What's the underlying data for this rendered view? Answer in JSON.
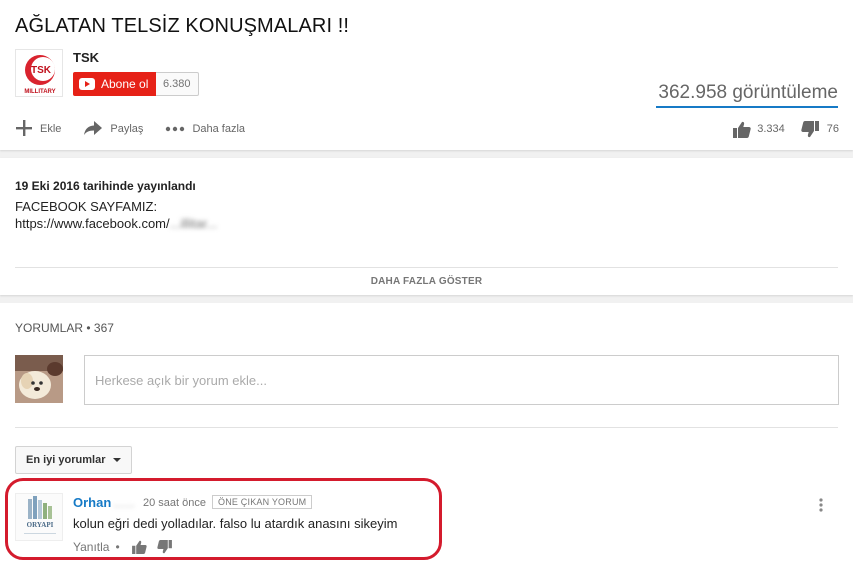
{
  "video": {
    "title": "AĞLATAN TELSİZ KONUŞMALARI !!",
    "views": "362.958 görüntüleme",
    "likes": "3.334",
    "dislikes": "76"
  },
  "channel": {
    "name": "TSK",
    "avatar_text": "TSK",
    "avatar_subtext": "MILLITARY",
    "subscribe_label": "Abone ol",
    "subscriber_count": "6.380"
  },
  "actions": {
    "add_label": "Ekle",
    "share_label": "Paylaş",
    "more_label": "Daha fazla"
  },
  "description": {
    "publish_date": "19 Eki 2016 tarihinde yayınlandı",
    "line1": "FACEBOOK SAYFAMIZ:",
    "url_prefix": "https://www.facebook.com/",
    "url_obscured": "...illitar...",
    "show_more_label": "DAHA FAZLA GÖSTER"
  },
  "comments": {
    "header_label": "YORUMLAR",
    "header_separator": " • ",
    "count": "367",
    "input_placeholder": "Herkese açık bir yorum ekle...",
    "sort_label": "En iyi yorumlar",
    "items": [
      {
        "author": "Orhan",
        "author_obscured": "......",
        "time": "20 saat önce",
        "badge": "ÖNE ÇIKAN YORUM",
        "text": "kolun eğri dedi yolladılar. falso lu atardık anasını sikeyim",
        "reply_label": "Yanıtla",
        "avatar_text": "ORYAPI"
      }
    ]
  },
  "colors": {
    "accent_blue": "#167ac6",
    "subscribe_red": "#e62117",
    "highlight_red": "#d41b2d"
  }
}
